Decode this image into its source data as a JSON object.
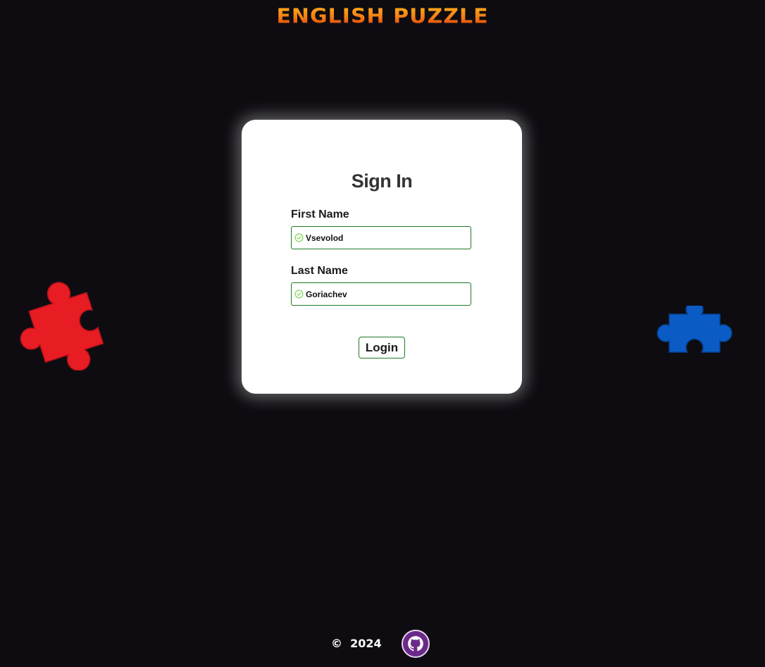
{
  "app": {
    "title": "ENGLISH PUZZLE"
  },
  "signin": {
    "title": "Sign In",
    "first_name": {
      "label": "First Name",
      "value": "Vsevolod",
      "valid": true
    },
    "last_name": {
      "label": "Last Name",
      "value": "Goriachev",
      "valid": true
    },
    "login_label": "Login"
  },
  "decor": {
    "left_piece": {
      "icon": "puzzle-piece-icon",
      "color": "#e81c23"
    },
    "right_piece": {
      "icon": "puzzle-piece-icon",
      "color": "#0a5bc4"
    }
  },
  "footer": {
    "copyright_symbol": "©",
    "year": "2024",
    "github_icon": "github-icon"
  },
  "colors": {
    "background": "#0e0c11",
    "accent_green": "#1d7a24",
    "valid_check": "#7ed957",
    "title_orange": "#f47a12",
    "github_purple": "#6b2a8a"
  }
}
